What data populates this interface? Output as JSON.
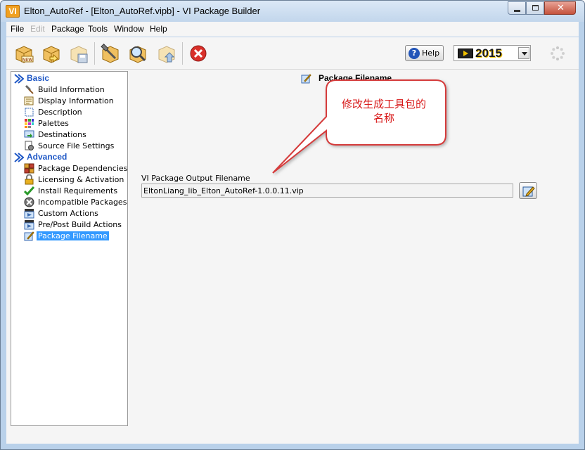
{
  "window": {
    "app_icon": "VI",
    "title": "Elton_AutoRef - [Elton_AutoRef.vipb] - VI Package Builder",
    "close_glyph": "✕"
  },
  "menu": {
    "items": [
      "File",
      "Edit",
      "Package",
      "Tools",
      "Window",
      "Help"
    ]
  },
  "toolbar": {
    "icons": [
      "new-package-icon",
      "open-package-icon",
      "save-package-icon",
      "build-package-icon",
      "browse-package-icon",
      "publish-package-icon",
      "stop-icon"
    ],
    "help_label": "Help",
    "version": "2015",
    "colors": {
      "stop": "#d9302a",
      "help": "#2355b8",
      "version_accent": "#f2c200"
    }
  },
  "nav": {
    "sections": [
      {
        "label": "Basic",
        "items": [
          {
            "label": "Build Information",
            "icon": "hammer-icon"
          },
          {
            "label": "Display Information",
            "icon": "display-info-icon"
          },
          {
            "label": "Description",
            "icon": "description-icon"
          },
          {
            "label": "Palettes",
            "icon": "palette-icon"
          },
          {
            "label": "Destinations",
            "icon": "destination-icon"
          },
          {
            "label": "Source File Settings",
            "icon": "source-file-icon"
          }
        ]
      },
      {
        "label": "Advanced",
        "items": [
          {
            "label": "Package Dependencies",
            "icon": "dependencies-icon"
          },
          {
            "label": "Licensing & Activation",
            "icon": "lock-icon"
          },
          {
            "label": "Install Requirements",
            "icon": "checkmark-icon"
          },
          {
            "label": "Incompatible Packages",
            "icon": "incompatible-icon"
          },
          {
            "label": "Custom Actions",
            "icon": "custom-actions-icon"
          },
          {
            "label": "Pre/Post Build Actions",
            "icon": "build-actions-icon"
          },
          {
            "label": "Package Filename",
            "icon": "filename-icon",
            "selected": true
          }
        ]
      }
    ],
    "selected_color": "#3399ff"
  },
  "panel": {
    "title": "Package Filename",
    "field_label": "VI Package Output Filename",
    "filename": "EltonLiang_lib_Elton_AutoRef-1.0.0.11.vip"
  },
  "annotation": {
    "text_line1": "修改生成工具包的",
    "text_line2": "名称",
    "color": "#d81818"
  }
}
